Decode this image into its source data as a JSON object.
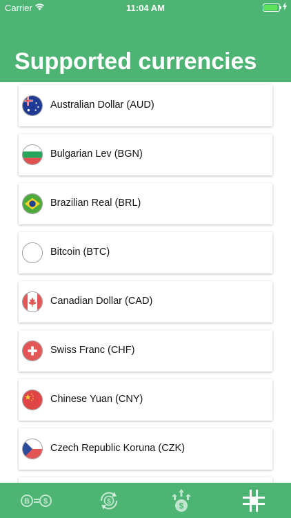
{
  "status_bar": {
    "carrier": "Carrier",
    "time": "11:04 AM",
    "battery_level": 0.9
  },
  "header": {
    "title": "Supported currencies"
  },
  "currencies": [
    {
      "label": "Australian Dollar (AUD)",
      "flag": "australia-flag"
    },
    {
      "label": "Bulgarian Lev (BGN)",
      "flag": "bulgaria-flag"
    },
    {
      "label": "Brazilian Real (BRL)",
      "flag": "brazil-flag"
    },
    {
      "label": "Bitcoin (BTC)",
      "flag": "blank-flag"
    },
    {
      "label": "Canadian Dollar (CAD)",
      "flag": "canada-flag"
    },
    {
      "label": "Swiss Franc (CHF)",
      "flag": "switzerland-flag"
    },
    {
      "label": "Chinese Yuan (CNY)",
      "flag": "china-flag"
    },
    {
      "label": "Czech Republic Koruna (CZK)",
      "flag": "czech-flag"
    }
  ],
  "tab_bar": {
    "tabs": [
      {
        "icon": "convert-icon"
      },
      {
        "icon": "refresh-rates-icon"
      },
      {
        "icon": "upload-rates-icon"
      },
      {
        "icon": "currencies-grid-icon",
        "active": true
      }
    ]
  },
  "colors": {
    "accent": "#4db474",
    "text": "#111111"
  }
}
